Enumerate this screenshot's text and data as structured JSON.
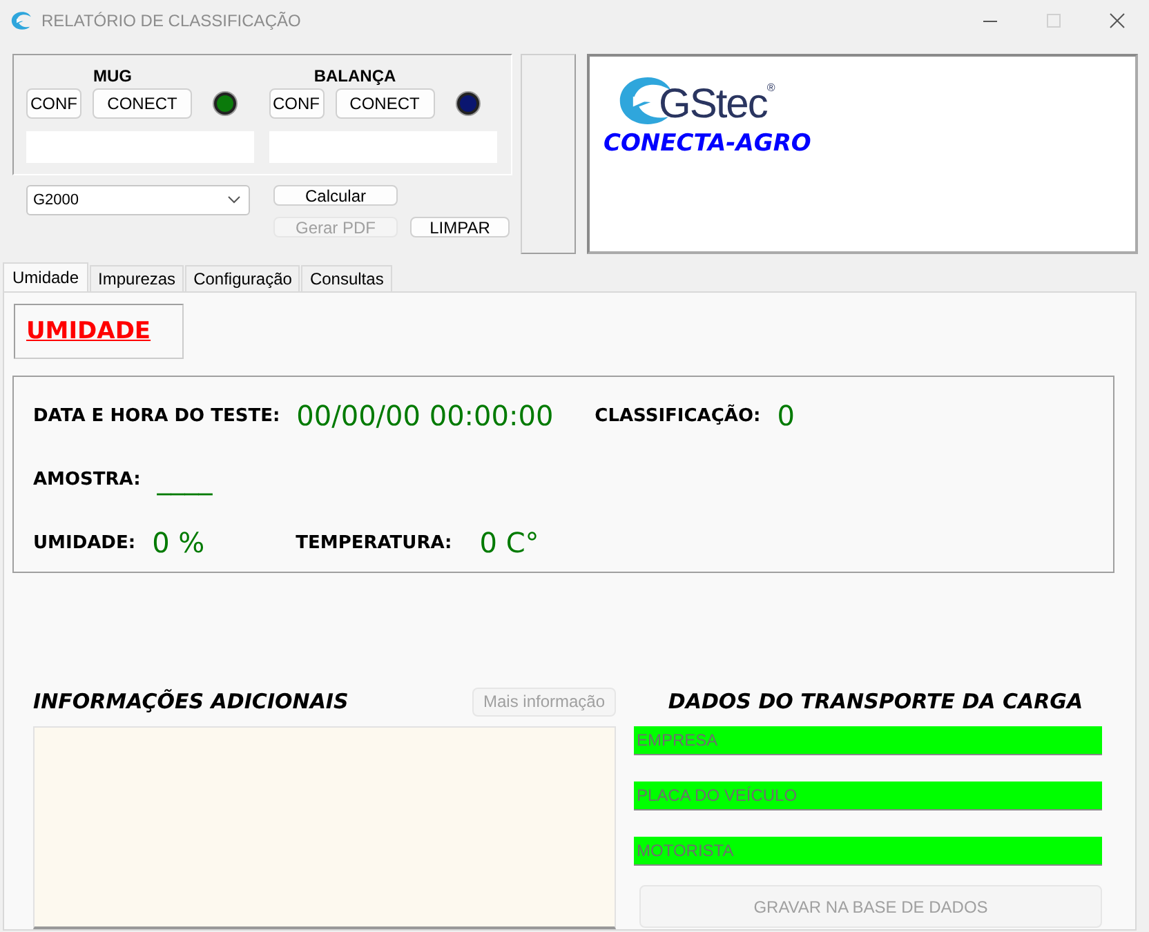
{
  "window": {
    "title": "RELATÓRIO DE CLASSIFICAÇÃO",
    "maximize_disabled": true
  },
  "devices": [
    {
      "name": "MUG",
      "buttons": [
        "CONF",
        "CONECT"
      ],
      "color": "#0b7a0b"
    },
    {
      "name": "BALANÇA",
      "buttons": [
        "CONF",
        "CONECT"
      ],
      "color": "#0a1670"
    }
  ],
  "model_select": {
    "value": "G2000"
  },
  "actions": [
    {
      "label": "Calcular",
      "disabled": false
    },
    {
      "label": "Gerar PDF",
      "disabled": true
    },
    {
      "label": "LIMPAR",
      "disabled": false
    }
  ],
  "logo": {
    "brand": "GStec",
    "mark": "®",
    "product": "CONECTA-AGRO"
  },
  "tabs": [
    {
      "label": "Umidade",
      "selected": true
    },
    {
      "label": "Impurezas",
      "selected": false
    },
    {
      "label": "Configuração",
      "selected": false
    },
    {
      "label": "Consultas",
      "selected": false
    }
  ],
  "section_title": "UMIDADE",
  "test_info": {
    "rows": [
      [
        {
          "label": "DATA E HORA DO TESTE:",
          "value": "00/00/00 00:00:00"
        },
        {
          "label": "CLASSIFICAÇÃO:",
          "value": "0"
        }
      ],
      [
        {
          "label": "AMOSTRA:",
          "value": "____"
        }
      ],
      [
        {
          "label": "UMIDADE:",
          "value": "0 %"
        },
        {
          "label": "TEMPERATURA:",
          "value": "0 C°"
        }
      ]
    ]
  },
  "additional_info": {
    "title": "INFORMAÇÕES ADICIONAIS",
    "button": {
      "label": "Mais informação",
      "disabled": true
    }
  },
  "transport": {
    "title": "DADOS DO TRANSPORTE DA CARGA",
    "fields": [
      {
        "placeholder": "EMPRESA"
      },
      {
        "placeholder": "PLACA DO VEÍCULO"
      },
      {
        "placeholder": "MOTORISTA"
      }
    ],
    "button": {
      "label": "GRAVAR NA BASE DE DADOS",
      "disabled": true
    }
  }
}
